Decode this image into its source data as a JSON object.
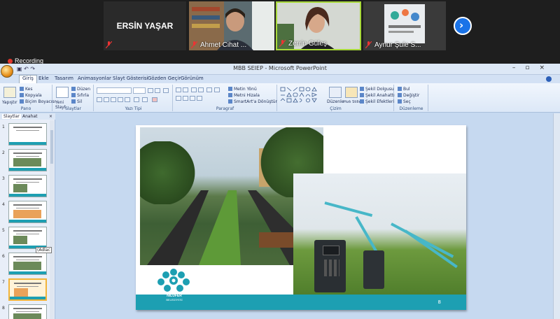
{
  "conference": {
    "participants": [
      {
        "name": "ERSİN YAŞAR",
        "mic_icon": "mic-off-icon"
      },
      {
        "name": "Ahmet Cihat ...",
        "mic_icon": "mic-off-icon"
      },
      {
        "name": "Zerrin Güleş",
        "mic_icon": "mic-off-icon"
      },
      {
        "name": "Aynur Şule S...",
        "mic_icon": "mic-off-icon"
      }
    ],
    "next_icon": "chevron-right-icon",
    "recording_label": "Recording"
  },
  "ppt": {
    "window_title": "MBB SEIEP - Microsoft PowerPoint",
    "tabs": [
      "Giriş",
      "Ekle",
      "Tasarım",
      "Animasyonlar",
      "Slayt Gösterisi",
      "Gözden Geçir",
      "Görünüm"
    ],
    "ribbon": {
      "groups": [
        "Pano",
        "Slaytlar",
        "Yazı Tipi",
        "Paragraf",
        "Çizim",
        "Düzenleme"
      ],
      "pano": {
        "paste": "Yapıştır",
        "cut": "Kes",
        "copy": "Kopyala",
        "format_painter": "Biçim Boyacısı"
      },
      "slaytlar": {
        "new_slide": "Yeni Slayt",
        "layout": "Düzen",
        "reset": "Sıfırla",
        "delete": "Sil"
      },
      "paragraf": {
        "text_direction": "Metin Yönü",
        "align_text": "Metni Hizala",
        "smartart": "SmartArt'a Dönüştür"
      },
      "cizim": {
        "arrange": "Düzenle",
        "quick_styles": "Hızlı Stiller",
        "shape_fill": "Şekil Dolgusu",
        "shape_outline": "Şekil Anahattı",
        "shape_effects": "Şekil Efektleri"
      },
      "duzenleme": {
        "find": "Bul",
        "replace": "Değiştir",
        "select": "Seç"
      }
    },
    "left_pane": {
      "tabs": [
        "Slaytlar",
        "Anahat"
      ],
      "slide_numbers": [
        "1",
        "2",
        "3",
        "4",
        "5",
        "6",
        "7",
        "8"
      ],
      "selected_slide": "7",
      "tooltip": "(Adlac"
    },
    "slide": {
      "page_number": "8",
      "logo_name": "NİLÜFER",
      "logo_sub": "BELEDİYESİ",
      "accent": "#1d9fb2"
    }
  }
}
